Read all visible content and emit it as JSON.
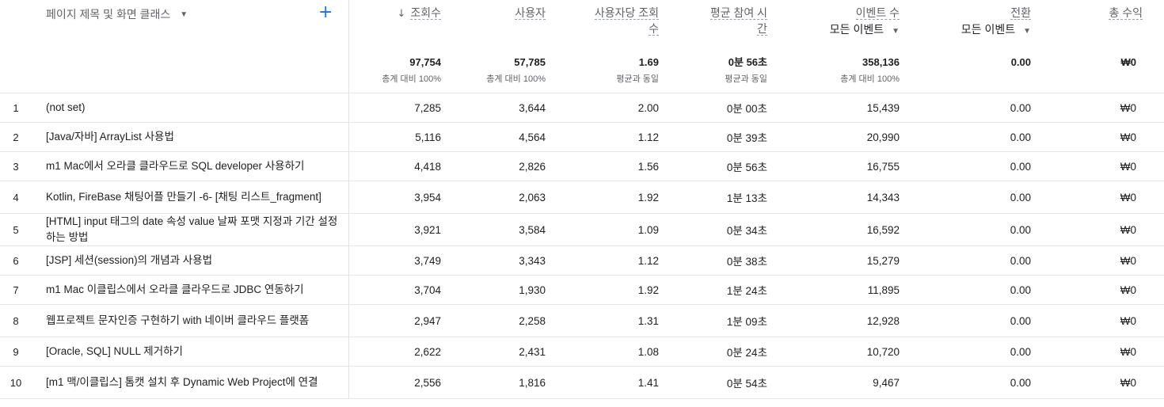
{
  "header": {
    "dimension_label": "페이지 제목 및 화면 클래스",
    "add_symbol": "+",
    "columns": [
      {
        "key": "views",
        "lines": [
          "조회수"
        ],
        "sort": "↓",
        "sub": "",
        "total": "97,754",
        "total_caption": "총계 대비 100%"
      },
      {
        "key": "users",
        "lines": [
          "사용자"
        ],
        "sub": "",
        "total": "57,785",
        "total_caption": "총계 대비 100%"
      },
      {
        "key": "views_per_user",
        "lines": [
          "사용자당 조회",
          "수"
        ],
        "sub": "",
        "total": "1.69",
        "total_caption": "평균과 동일"
      },
      {
        "key": "engagement",
        "lines": [
          "평균 참여 시",
          "간"
        ],
        "sub": "",
        "total": "0분 56초",
        "total_caption": "평균과 동일"
      },
      {
        "key": "events",
        "lines": [
          "이벤트 수"
        ],
        "sub": "모든 이벤트",
        "total": "358,136",
        "total_caption": "총계 대비 100%"
      },
      {
        "key": "conversions",
        "lines": [
          "전환"
        ],
        "sub": "모든 이벤트",
        "total": "0.00",
        "total_caption": ""
      },
      {
        "key": "revenue",
        "lines": [
          "총 수익"
        ],
        "sub": "",
        "total": "₩0",
        "total_caption": ""
      }
    ]
  },
  "rows": [
    {
      "idx": "1",
      "title": "(not set)",
      "views": "7,285",
      "users": "3,644",
      "views_per_user": "2.00",
      "engagement": "0분 00초",
      "events": "15,439",
      "conversions": "0.00",
      "revenue": "₩0"
    },
    {
      "idx": "2",
      "title": "[Java/자바] ArrayList 사용법",
      "views": "5,116",
      "users": "4,564",
      "views_per_user": "1.12",
      "engagement": "0분 39초",
      "events": "20,990",
      "conversions": "0.00",
      "revenue": "₩0"
    },
    {
      "idx": "3",
      "title": "m1 Mac에서 오라클 클라우드로 SQL developer 사용하기",
      "views": "4,418",
      "users": "2,826",
      "views_per_user": "1.56",
      "engagement": "0분 56초",
      "events": "16,755",
      "conversions": "0.00",
      "revenue": "₩0"
    },
    {
      "idx": "4",
      "title": "Kotlin, FireBase 채팅어플 만들기 -6- [채팅 리스트_fragment]",
      "views": "3,954",
      "users": "2,063",
      "views_per_user": "1.92",
      "engagement": "1분 13초",
      "events": "14,343",
      "conversions": "0.00",
      "revenue": "₩0"
    },
    {
      "idx": "5",
      "title": "[HTML] input 태그의 date 속성 value 날짜 포맷 지정과 기간 설정하는 방법",
      "views": "3,921",
      "users": "3,584",
      "views_per_user": "1.09",
      "engagement": "0분 34초",
      "events": "16,592",
      "conversions": "0.00",
      "revenue": "₩0"
    },
    {
      "idx": "6",
      "title": "[JSP] 세션(session)의 개념과 사용법",
      "views": "3,749",
      "users": "3,343",
      "views_per_user": "1.12",
      "engagement": "0분 38초",
      "events": "15,279",
      "conversions": "0.00",
      "revenue": "₩0"
    },
    {
      "idx": "7",
      "title": "m1 Mac 이클립스에서 오라클 클라우드로 JDBC 연동하기",
      "views": "3,704",
      "users": "1,930",
      "views_per_user": "1.92",
      "engagement": "1분 24초",
      "events": "11,895",
      "conversions": "0.00",
      "revenue": "₩0"
    },
    {
      "idx": "8",
      "title": "웹프로젝트 문자인증 구현하기 with 네이버 클라우드 플랫폼",
      "views": "2,947",
      "users": "2,258",
      "views_per_user": "1.31",
      "engagement": "1분 09초",
      "events": "12,928",
      "conversions": "0.00",
      "revenue": "₩0"
    },
    {
      "idx": "9",
      "title": "[Oracle, SQL] NULL 제거하기",
      "views": "2,622",
      "users": "2,431",
      "views_per_user": "1.08",
      "engagement": "0분 24초",
      "events": "10,720",
      "conversions": "0.00",
      "revenue": "₩0"
    },
    {
      "idx": "10",
      "title": "[m1 맥/이클립스] 톰캣 설치 후 Dynamic Web Project에 연결",
      "views": "2,556",
      "users": "1,816",
      "views_per_user": "1.41",
      "engagement": "0분 54초",
      "events": "9,467",
      "conversions": "0.00",
      "revenue": "₩0"
    }
  ],
  "colors": {
    "accent": "#1a73e8",
    "border": "#e6e6e6",
    "muted_text": "#5f6368",
    "text": "#202124"
  },
  "icons": {
    "add": "plus-icon",
    "dropdown": "caret-down-icon",
    "sort": "arrow-down-icon"
  }
}
